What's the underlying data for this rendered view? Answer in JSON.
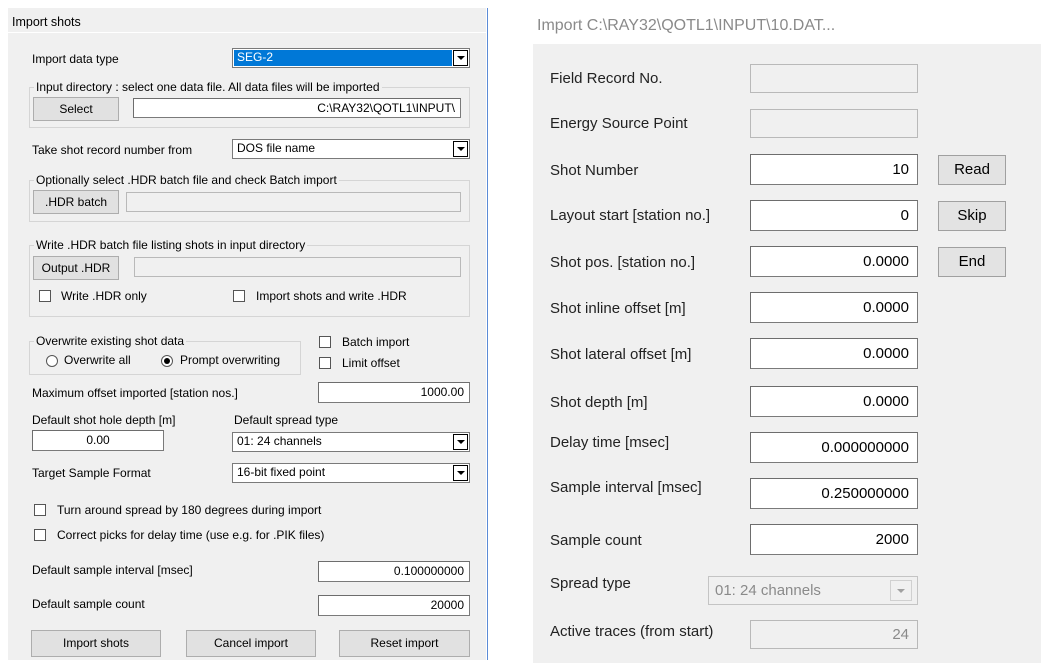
{
  "left": {
    "title": "Import shots",
    "import_data_type": {
      "label": "Import data type",
      "value": "SEG-2"
    },
    "input_dir_group": "Input directory : select one data file. All data files will be imported",
    "select_button": "Select",
    "input_path": "C:\\RAY32\\QOTL1\\INPUT\\",
    "shot_record_from": {
      "label": "Take shot record number from",
      "value": "DOS file name"
    },
    "hdr_group": "Optionally select .HDR batch file and check Batch import",
    "hdr_batch_button": ".HDR batch",
    "hdr_batch_path": "",
    "write_group": "Write .HDR batch file listing shots in input directory",
    "output_hdr_button": "Output .HDR",
    "output_hdr_path": "",
    "write_hdr_only": "Write .HDR only",
    "import_and_write": "Import shots and write .HDR",
    "overwrite_group": "Overwrite existing shot data",
    "overwrite_all": "Overwrite all",
    "prompt_overwriting": "Prompt overwriting",
    "batch_import": "Batch import",
    "limit_offset": "Limit offset",
    "max_offset": {
      "label": "Maximum offset imported [station nos.]",
      "value": "1000.00"
    },
    "shot_hole_depth": {
      "label": "Default shot hole depth [m]",
      "value": "0.00"
    },
    "spread_type": {
      "label": "Default spread type",
      "value": "01:  24 channels"
    },
    "target_format": {
      "label": "Target Sample Format",
      "value": "16-bit fixed point"
    },
    "turn_around": "Turn around spread by 180 degrees during import",
    "correct_picks": "Correct picks for delay time (use e.g. for .PIK files)",
    "sample_interval": {
      "label": "Default sample interval [msec]",
      "value": "0.100000000"
    },
    "sample_count": {
      "label": "Default sample count",
      "value": "20000"
    },
    "import_button": "Import shots",
    "cancel_button": "Cancel import",
    "reset_button": "Reset import"
  },
  "right": {
    "title": "Import C:\\RAY32\\QOTL1\\INPUT\\10.DAT...",
    "field_record": {
      "label": "Field Record No.",
      "value": ""
    },
    "energy_source": {
      "label": "Energy Source Point",
      "value": ""
    },
    "shot_number": {
      "label": "Shot Number",
      "value": "10"
    },
    "layout_start": {
      "label": "Layout start [station no.]",
      "value": "0"
    },
    "shot_pos": {
      "label": "Shot pos. [station no.]",
      "value": "0.0000"
    },
    "inline_offset": {
      "label": "Shot inline offset [m]",
      "value": "0.0000"
    },
    "lateral_offset": {
      "label": "Shot lateral offset [m]",
      "value": "0.0000"
    },
    "shot_depth": {
      "label": "Shot depth [m]",
      "value": "0.0000"
    },
    "delay_time": {
      "label": "Delay time [msec]",
      "value": "0.000000000"
    },
    "sample_interval": {
      "label": "Sample interval [msec]",
      "value": "0.250000000"
    },
    "sample_count": {
      "label": "Sample count",
      "value": "2000"
    },
    "spread_type": {
      "label": "Spread type",
      "value": "01:  24 channels"
    },
    "active_traces": {
      "label": "Active traces (from start)",
      "value": "24"
    },
    "read_button": "Read",
    "skip_button": "Skip",
    "end_button": "End"
  }
}
